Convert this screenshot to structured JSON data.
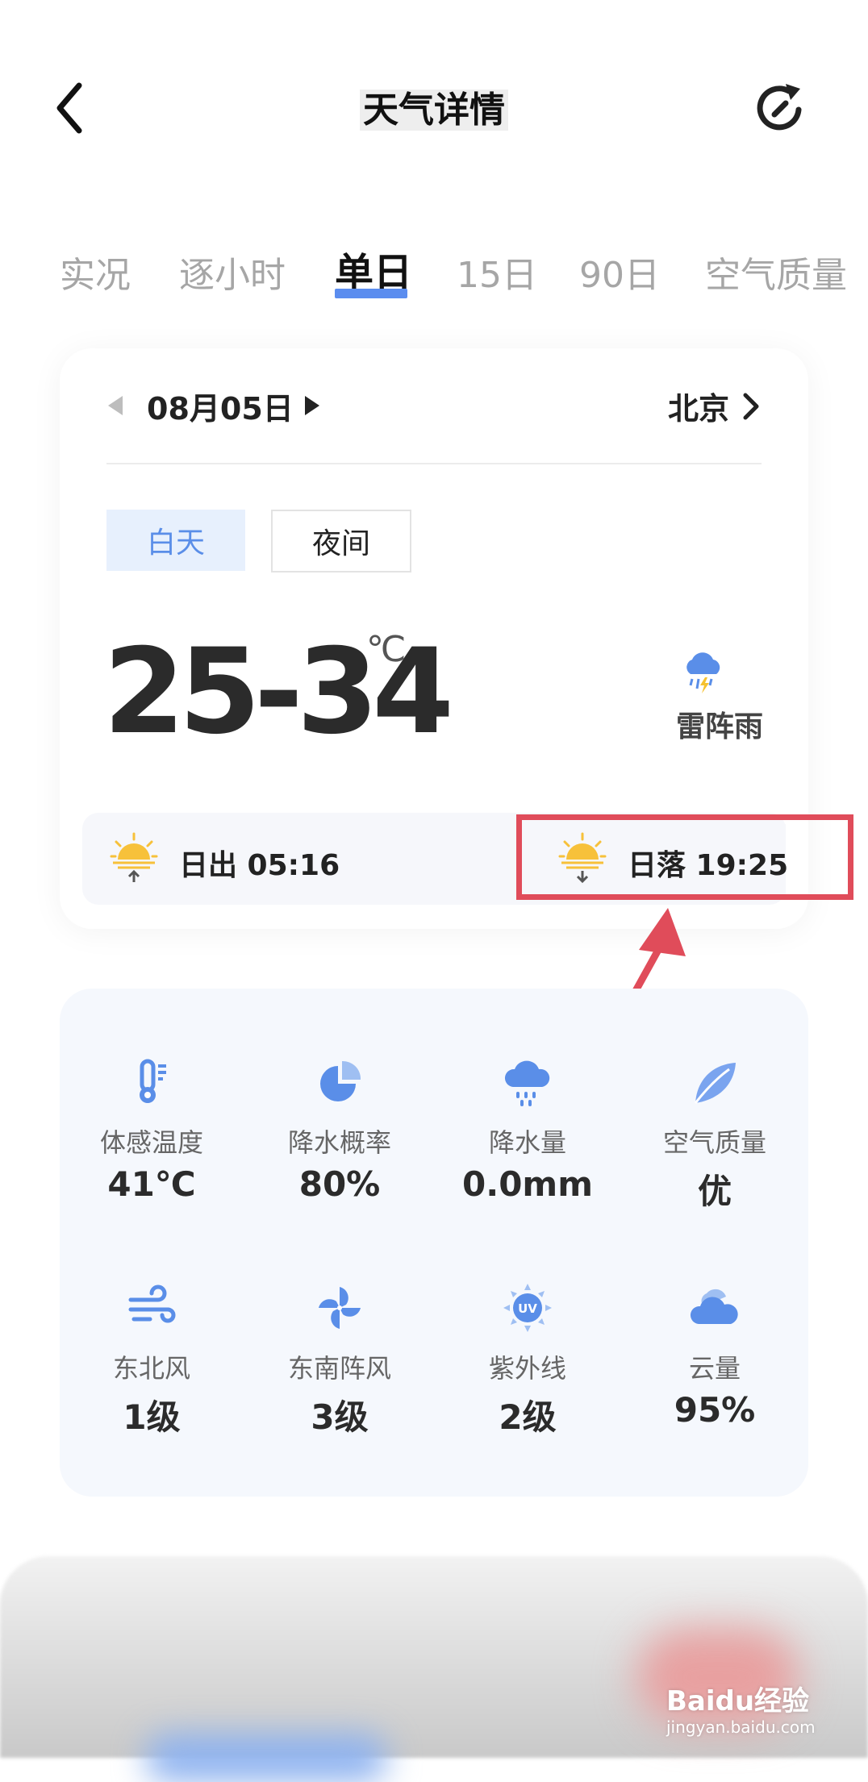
{
  "header": {
    "title": "天气详情"
  },
  "tabs": [
    {
      "label": "实况"
    },
    {
      "label": "逐小时"
    },
    {
      "label": "单日",
      "active": true
    },
    {
      "label": "15日"
    },
    {
      "label": "90日"
    },
    {
      "label": "空气质量"
    }
  ],
  "day_card": {
    "date": "08月05日",
    "city": "北京",
    "toggle": {
      "day": "白天",
      "night": "夜间",
      "selected": "白天"
    },
    "temperature": "25-34",
    "unit": "℃",
    "condition": "雷阵雨",
    "sunrise": "日出 05:16",
    "sunset": "日落 19:25"
  },
  "metrics": [
    {
      "icon": "thermometer-icon",
      "label": "体感温度",
      "value": "41℃"
    },
    {
      "icon": "pie-chart-icon",
      "label": "降水概率",
      "value": "80%"
    },
    {
      "icon": "rain-cloud-icon",
      "label": "降水量",
      "value": "0.0mm"
    },
    {
      "icon": "leaf-icon",
      "label": "空气质量",
      "value": "优"
    },
    {
      "icon": "wind-icon",
      "label": "东北风",
      "value": "1级"
    },
    {
      "icon": "pinwheel-icon",
      "label": "东南阵风",
      "value": "3级"
    },
    {
      "icon": "uv-icon",
      "label": "紫外线",
      "value": "2级"
    },
    {
      "icon": "cloud-icon",
      "label": "云量",
      "value": "95%"
    }
  ],
  "colors": {
    "accent": "#5b8def",
    "icon": "#5a8ee8",
    "highlight": "#e04c5a"
  },
  "watermark": {
    "brand": "Baidu经验",
    "url": "jingyan.baidu.com"
  }
}
